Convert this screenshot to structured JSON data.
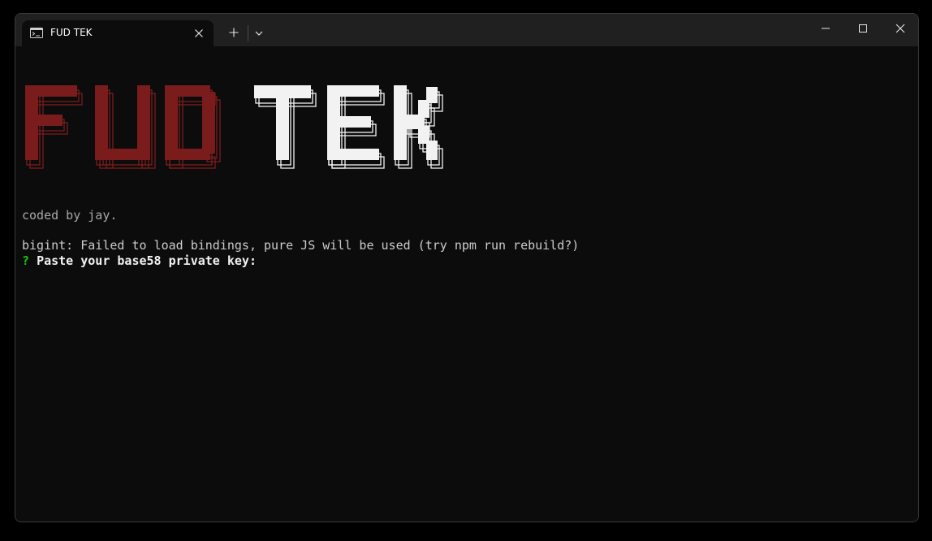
{
  "tab": {
    "title": "FUD TEK",
    "icon": "terminal-icon"
  },
  "titlebar": {
    "new_tab_icon": "plus-icon",
    "dropdown_icon": "chevron-down-icon",
    "minimize_icon": "minimize-icon",
    "maximize_icon": "maximize-icon",
    "close_icon": "close-icon"
  },
  "banner": {
    "word1": "FUD",
    "word2": "TEK",
    "word1_color": "#7b1c1c",
    "word2_color": "#f2f2f2"
  },
  "terminal": {
    "credit": "coded by jay.",
    "warning": "bigint: Failed to load bindings, pure JS will be used (try npm run rebuild?)",
    "prompt_symbol": "?",
    "prompt_text": "Paste your base58 private key:",
    "prompt_symbol_color": "#16c60c"
  }
}
